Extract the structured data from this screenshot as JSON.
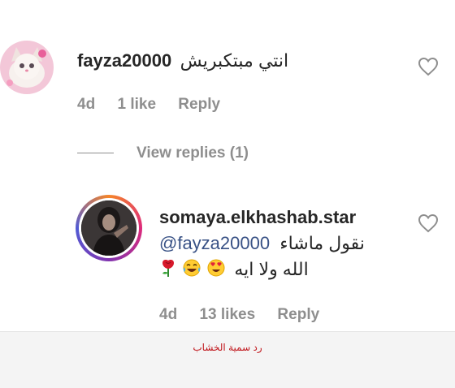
{
  "comment1": {
    "username": "fayza20000",
    "text": "انتي مبتكبريش",
    "time": "4d",
    "likes": "1 like",
    "reply_label": "Reply"
  },
  "view_replies": "View replies (1)",
  "reply1": {
    "username": "somaya.elkhashab.star",
    "mention": "@fayza20000",
    "text_line1": "نقول ماشاء",
    "text_line2": "الله ولا ايه",
    "time": "4d",
    "likes": "13 likes",
    "reply_label": "Reply"
  },
  "footer": {
    "caption": "رد سمية الخشاب"
  },
  "icons": {
    "heart": "heart-outline-icon",
    "emojis": [
      "rose-emoji",
      "tears-of-joy-emoji",
      "heart-eyes-emoji"
    ]
  },
  "colors": {
    "meta_gray": "#8e8e8e",
    "link_blue": "#385185",
    "caption_red": "#c0151b"
  }
}
